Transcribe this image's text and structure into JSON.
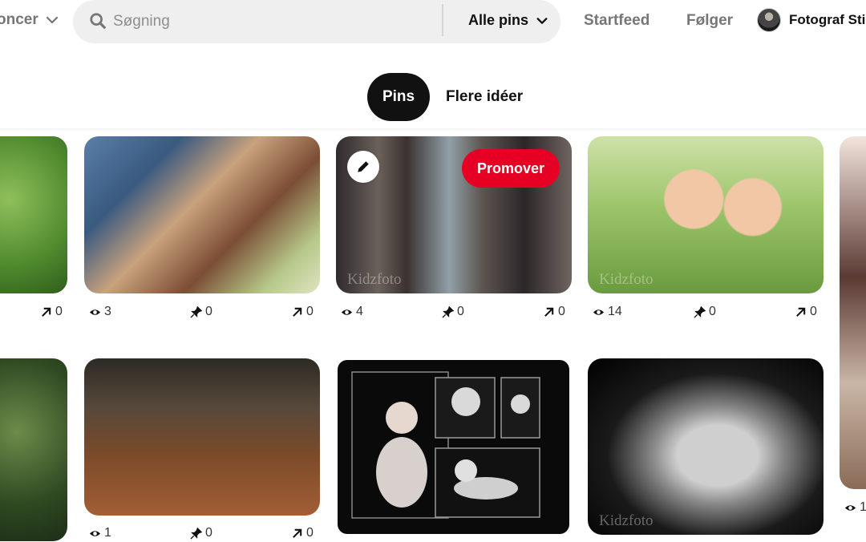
{
  "header": {
    "left_nav_label": "oncer",
    "search_placeholder": "Søgning",
    "search_scope": "Alle pins",
    "nav": [
      "Startfeed",
      "Følger"
    ],
    "profile_name": "Fotograf Sti"
  },
  "tabs": [
    {
      "label": "Pins",
      "active": true
    },
    {
      "label": "Flere idéer",
      "active": false
    }
  ],
  "pins": [
    {
      "views": "",
      "saves": "",
      "clicks": "0",
      "watermark": ""
    },
    {
      "views": "3",
      "saves": "0",
      "clicks": "0",
      "watermark": ""
    },
    {
      "views": "4",
      "saves": "0",
      "clicks": "0",
      "watermark": "Kidzfoto",
      "promote_label": "Promover"
    },
    {
      "views": "14",
      "saves": "0",
      "clicks": "0",
      "watermark": "Kidzfoto"
    },
    {
      "views": "1",
      "saves": "",
      "clicks": "",
      "watermark": ""
    },
    {
      "views": "",
      "saves": "",
      "clicks": "",
      "watermark": ""
    },
    {
      "views": "1",
      "saves": "0",
      "clicks": "0",
      "watermark": ""
    },
    {
      "views": "",
      "saves": "",
      "clicks": "",
      "watermark": ""
    },
    {
      "views": "",
      "saves": "",
      "clicks": "",
      "watermark": "Kidzfoto"
    }
  ],
  "colors": {
    "accent": "#e60023",
    "active_tab": "#111111"
  }
}
